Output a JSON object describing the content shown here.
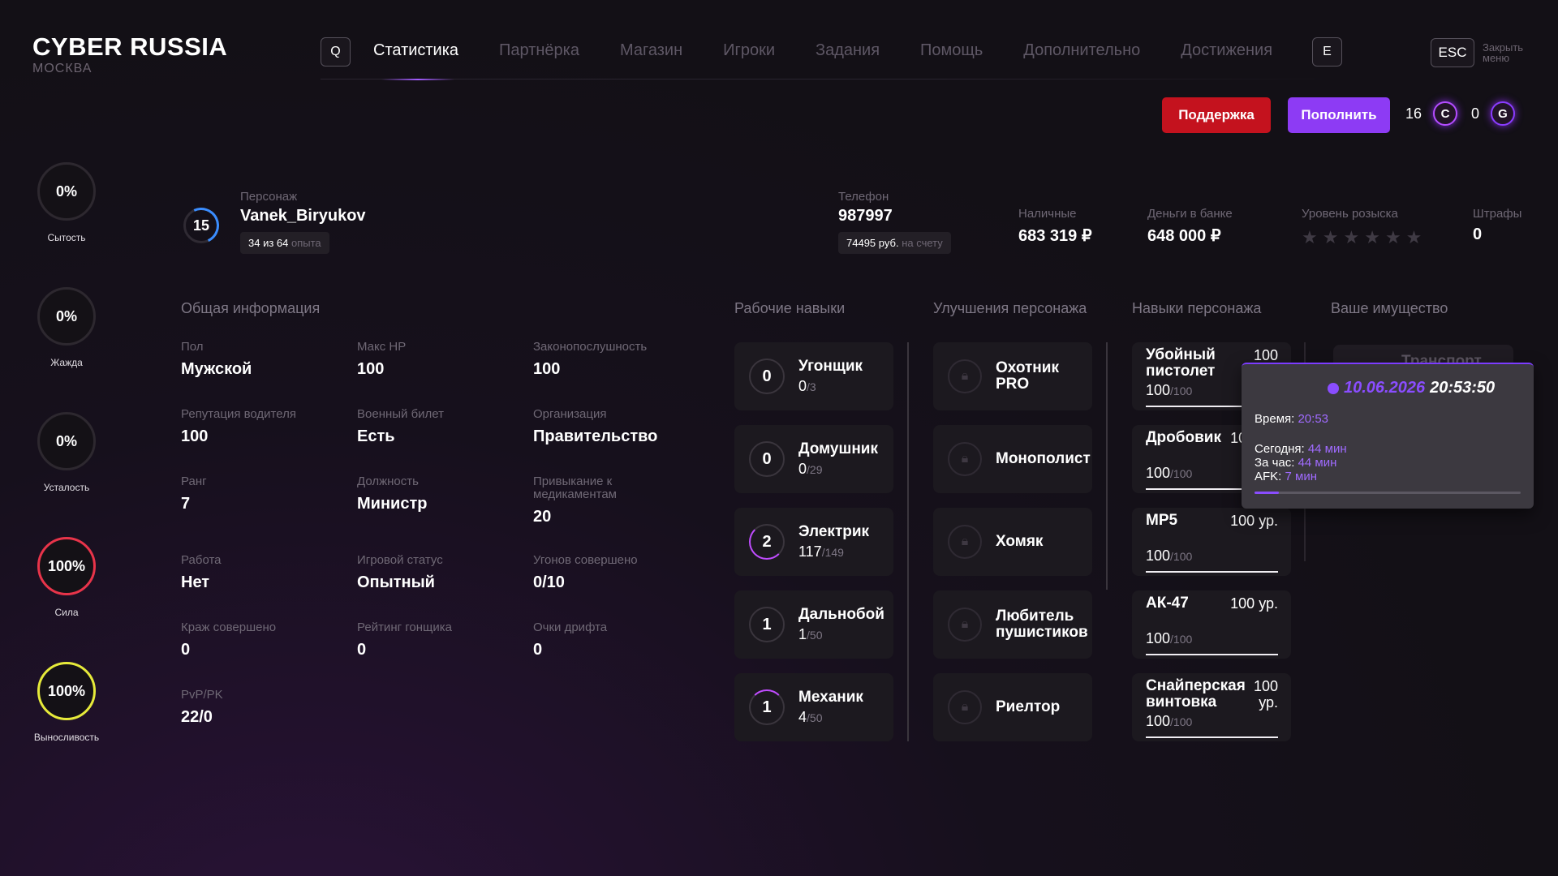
{
  "brand": {
    "title": "CYBER RUSSIA",
    "city": "МОСКВА"
  },
  "header": {
    "left_key": "Q",
    "right_key": "E",
    "tabs": [
      {
        "label": "Статистика",
        "active": true
      },
      {
        "label": "Партнёрка"
      },
      {
        "label": "Магазин"
      },
      {
        "label": "Игроки"
      },
      {
        "label": "Задания"
      },
      {
        "label": "Помощь"
      },
      {
        "label": "Дополнительно"
      },
      {
        "label": "Достижения"
      }
    ],
    "esc_key": "ESC",
    "esc_label": "Закрыть меню",
    "support_button": "Поддержка",
    "topup_button": "Пополнить",
    "currency_c": {
      "amount": "16",
      "icon": "C"
    },
    "currency_g": {
      "amount": "0",
      "icon": "G"
    }
  },
  "needs": [
    {
      "value": "0%",
      "label": "Сытость",
      "ring_color": "#2d282f"
    },
    {
      "value": "0%",
      "label": "Жажда",
      "ring_color": "#2d282f"
    },
    {
      "value": "0%",
      "label": "Усталость",
      "ring_color": "#2d282f"
    },
    {
      "value": "100%",
      "label": "Сила",
      "ring_color": "#e8344a"
    },
    {
      "value": "100%",
      "label": "Выносливость",
      "ring_color": "#e6ea3a"
    }
  ],
  "character": {
    "level": "15",
    "label": "Персонаж",
    "name": "Vanek_Biryukov",
    "exp_text": "34 из 64",
    "exp_suffix": "опыта",
    "phone_label": "Телефон",
    "phone": "987997",
    "phone_balance": "74495 руб.",
    "phone_balance_suffix": "на счету",
    "cash_label": "Наличные",
    "cash": "683 319 ₽",
    "bank_label": "Деньги в банке",
    "bank": "648 000 ₽",
    "wanted_label": "Уровень розыска",
    "wanted_stars": 0,
    "fines_label": "Штрафы",
    "fines": "0"
  },
  "sections": {
    "general": "Общая информация",
    "work_skills": "Рабочие навыки",
    "upgrades": "Улучшения персонажа",
    "char_skills": "Навыки персонажа",
    "property": "Ваше имущество"
  },
  "general_info": [
    {
      "label": "Пол",
      "value": "Мужской"
    },
    {
      "label": "Макс HP",
      "value": "100"
    },
    {
      "label": "Законопослушность",
      "value": "100"
    },
    {
      "label": "Репутация водителя",
      "value": "100"
    },
    {
      "label": "Военный билет",
      "value": "Есть"
    },
    {
      "label": "Организация",
      "value": "Правительство"
    },
    {
      "label": "Ранг",
      "value": "7"
    },
    {
      "label": "Должность",
      "value": "Министр"
    },
    {
      "label": "Привыкание к медикаментам",
      "value": "20"
    },
    {
      "label": "Работа",
      "value": "Нет"
    },
    {
      "label": "Игровой статус",
      "value": "Опытный"
    },
    {
      "label": "Угонов совершено",
      "value": "0/10"
    },
    {
      "label": "Краж совершено",
      "value": "0"
    },
    {
      "label": "Рейтинг гонщика",
      "value": "0"
    },
    {
      "label": "Очки дрифта",
      "value": "0"
    },
    {
      "label": "PvP/PK",
      "value": "22/0"
    }
  ],
  "work_skills": [
    {
      "level": "0",
      "name": "Угонщик",
      "progress": "0",
      "max": "/3"
    },
    {
      "level": "0",
      "name": "Домушник",
      "progress": "0",
      "max": "/29"
    },
    {
      "level": "2",
      "name": "Электрик",
      "progress": "117",
      "max": "/149"
    },
    {
      "level": "1",
      "name": "Дальнобой",
      "progress": "1",
      "max": "/50"
    },
    {
      "level": "1",
      "name": "Механик",
      "progress": "4",
      "max": "/50"
    }
  ],
  "upgrades": [
    {
      "name": "Охотник PRO"
    },
    {
      "name": "Монополист"
    },
    {
      "name": "Хомяк"
    },
    {
      "name": "Любитель пушистиков"
    },
    {
      "name": "Риелтор"
    }
  ],
  "weapons": [
    {
      "name": "Убойный пистолет",
      "level": "100 ур.",
      "progress": "100",
      "max": "/100"
    },
    {
      "name": "Дробовик",
      "level": "100 ур.",
      "progress": "100",
      "max": "/100"
    },
    {
      "name": "MP5",
      "level": "100 ур.",
      "progress": "100",
      "max": "/100"
    },
    {
      "name": "АК-47",
      "level": "100 ур.",
      "progress": "100",
      "max": "/100"
    },
    {
      "name": "Снайперская винтовка",
      "level": "100 ур.",
      "progress": "100",
      "max": "/100"
    }
  ],
  "property": {
    "transport": "Транспорт"
  },
  "tooltip": {
    "date": "10.06.2026",
    "time": "20:53:50",
    "time_label": "Время:",
    "time_value": "20:53",
    "today_label": "Сегодня:",
    "today_value": "44 мин",
    "hour_label": "За час:",
    "hour_value": "44 мин",
    "afk_label": "AFK:",
    "afk_value": "7 мин",
    "afk_fraction": 0.09
  },
  "colors": {
    "accent": "#8d3bf4",
    "support": "#c4121e"
  }
}
